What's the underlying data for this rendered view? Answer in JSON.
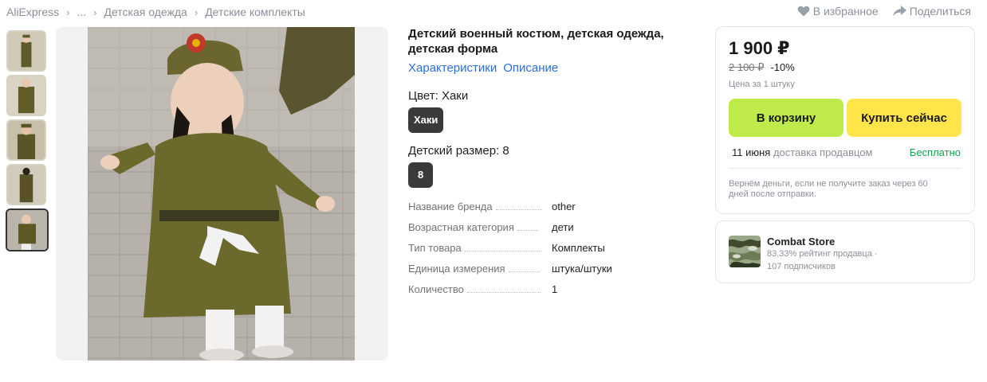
{
  "breadcrumb": [
    "AliExpress",
    "...",
    "Детская одежда",
    "Детские комплекты"
  ],
  "top_actions": {
    "favorite": "В избранное",
    "share": "Поделиться"
  },
  "product": {
    "title": "Детский военный костюм, детская одежда, детская форма",
    "links": [
      "Характеристики",
      "Описание"
    ],
    "color_label": "Цвет: Хаки",
    "color_chip": "Хаки",
    "size_label": "Детский размер: 8",
    "size_chip": "8",
    "specs": [
      {
        "key": "Название бренда",
        "value": "other"
      },
      {
        "key": "Возрастная категория",
        "value": "дети"
      },
      {
        "key": "Тип товара",
        "value": "Комплекты"
      },
      {
        "key": "Единица измерения",
        "value": "штука/штуки"
      },
      {
        "key": "Количество",
        "value": "1"
      }
    ]
  },
  "buybox": {
    "price": "1 900 ₽",
    "old_price": "2 100 ₽",
    "discount": "-10%",
    "unit_note": "Цена за 1 штуку",
    "add_to_cart": "В корзину",
    "buy_now": "Купить сейчас",
    "delivery_date": "11 июня",
    "delivery_by": "доставка продавцом",
    "delivery_price": "Бесплатно",
    "guarantee": "Вернём деньги, если не получите заказ через 60 дней после отправки."
  },
  "store": {
    "name": "Combat Store",
    "rating": "83,33% рейтинг продавца",
    "followers": "107 подписчиков"
  },
  "colors": {
    "link": "#2a6fdb",
    "cart_button": "#bfeb4a",
    "buy_button": "#ffe44a",
    "free_delivery": "#1aa34a",
    "chip": "#3a3a3a"
  },
  "gallery": {
    "thumbnail_count": 5,
    "active_index": 4
  }
}
